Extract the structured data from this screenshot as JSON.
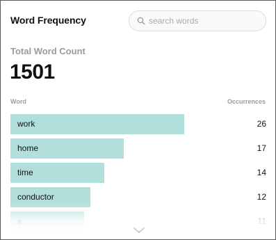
{
  "header": {
    "title": "Word Frequency",
    "search_placeholder": "search words",
    "search_value": ""
  },
  "summary": {
    "label": "Total Word Count",
    "value": "1501"
  },
  "table": {
    "col_word": "Word",
    "col_occurrences": "Occurrences",
    "max_count": 26,
    "rows": [
      {
        "word": "work",
        "count": 26
      },
      {
        "word": "home",
        "count": 17
      },
      {
        "word": "time",
        "count": 14
      },
      {
        "word": "conductor",
        "count": 12
      },
      {
        "word": "s",
        "count": 11
      }
    ]
  },
  "colors": {
    "bar": "#b2dfdb",
    "muted_text": "#9b9b9b"
  },
  "icons": {
    "search": "search-icon",
    "more": "chevron-down-icon"
  }
}
